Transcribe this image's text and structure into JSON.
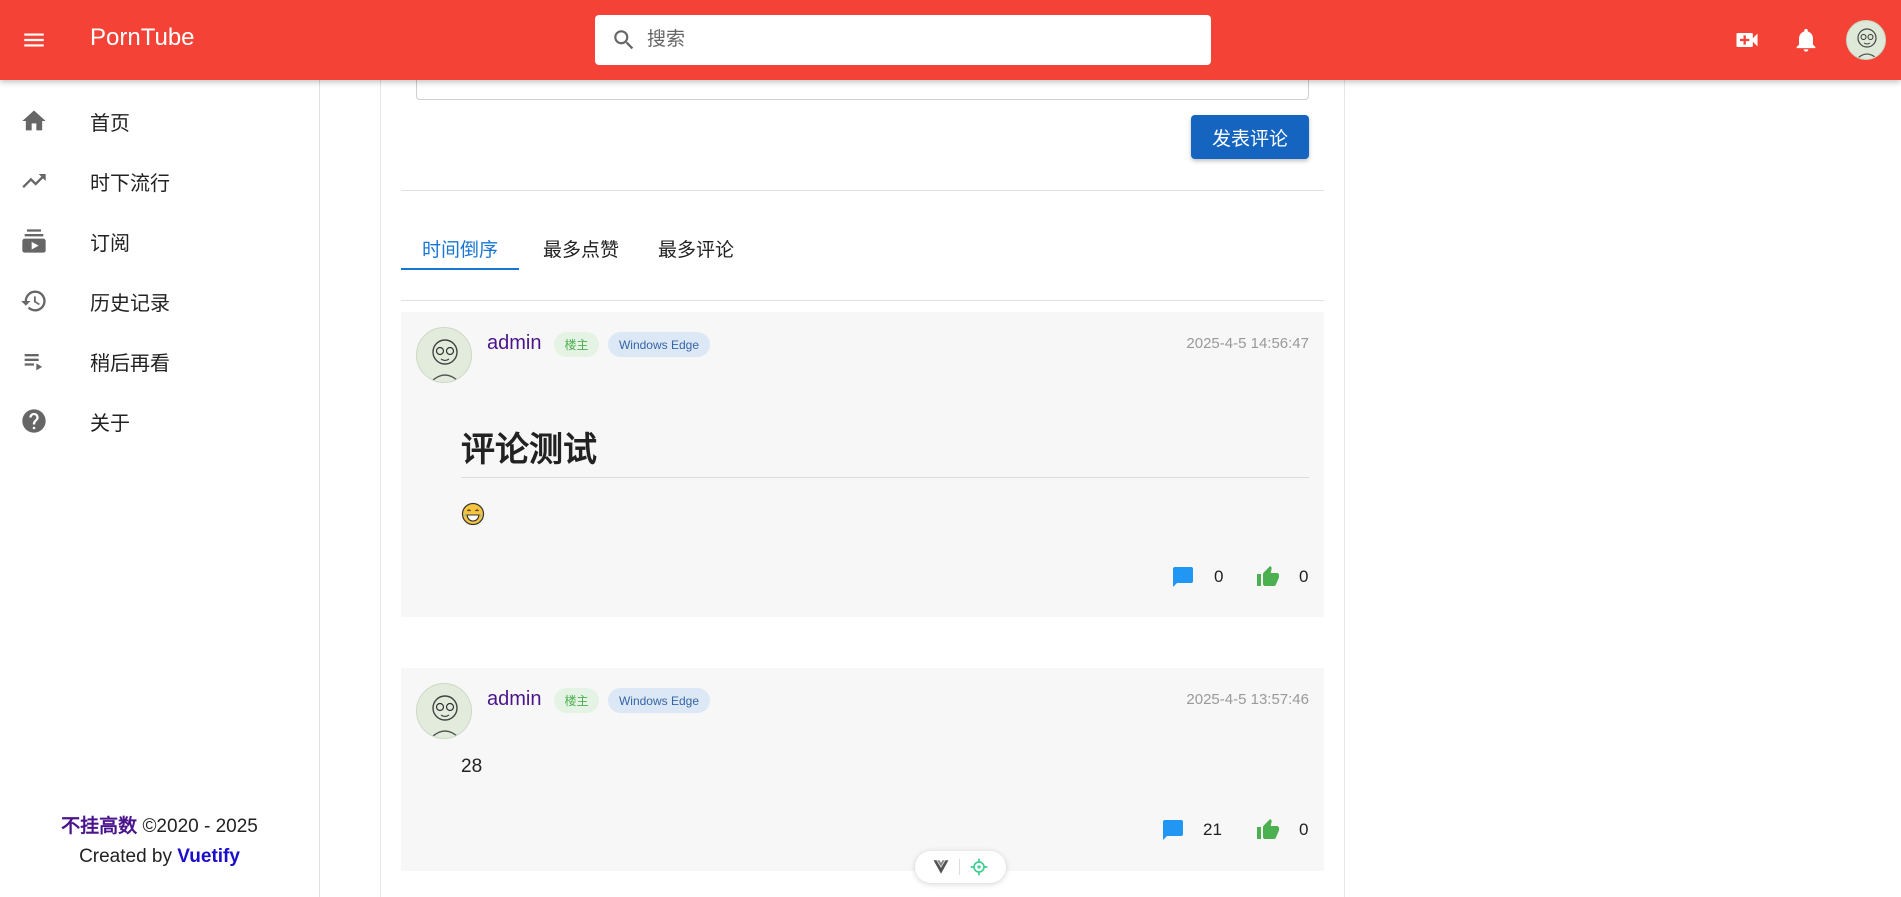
{
  "header": {
    "title": "PornTube",
    "search_placeholder": "搜索",
    "icons": [
      "menu-icon",
      "search-icon",
      "video-add-icon",
      "bell-icon",
      "avatar"
    ],
    "color": "#f44336"
  },
  "sidebar": {
    "items": [
      {
        "label": "首页",
        "icon": "home-icon"
      },
      {
        "label": "时下流行",
        "icon": "trending-icon"
      },
      {
        "label": "订阅",
        "icon": "subscriptions-icon"
      },
      {
        "label": "历史记录",
        "icon": "history-icon"
      },
      {
        "label": "稍后再看",
        "icon": "playlist-play-icon"
      },
      {
        "label": "关于",
        "icon": "help-icon"
      }
    ],
    "footer": {
      "brand": "不挂高数",
      "copyright": "©2020 - 2025",
      "created_by": "Created by",
      "vuetify": "Vuetify"
    }
  },
  "comment_form": {
    "submit_label": "发表评论"
  },
  "tabs": [
    {
      "label": "时间倒序",
      "active": true
    },
    {
      "label": "最多点赞",
      "active": false
    },
    {
      "label": "最多评论",
      "active": false
    }
  ],
  "comments": [
    {
      "user": "admin",
      "badge": "楼主",
      "user_agent": "Windows Edge",
      "time": "2025-4-5 14:56:47",
      "heading": "评论测试",
      "emoji": "grinning-face-with-tears",
      "replies": "0",
      "likes": "0"
    },
    {
      "user": "admin",
      "badge": "楼主",
      "user_agent": "Windows Edge",
      "time": "2025-4-5 13:57:46",
      "text": "28",
      "replies": "21",
      "likes": "0"
    }
  ],
  "colors": {
    "primary": "#1565c0",
    "tab_active": "#1976d2",
    "reply_icon": "#2196f3",
    "like_icon": "#4caf50",
    "username": "#4a148c"
  }
}
